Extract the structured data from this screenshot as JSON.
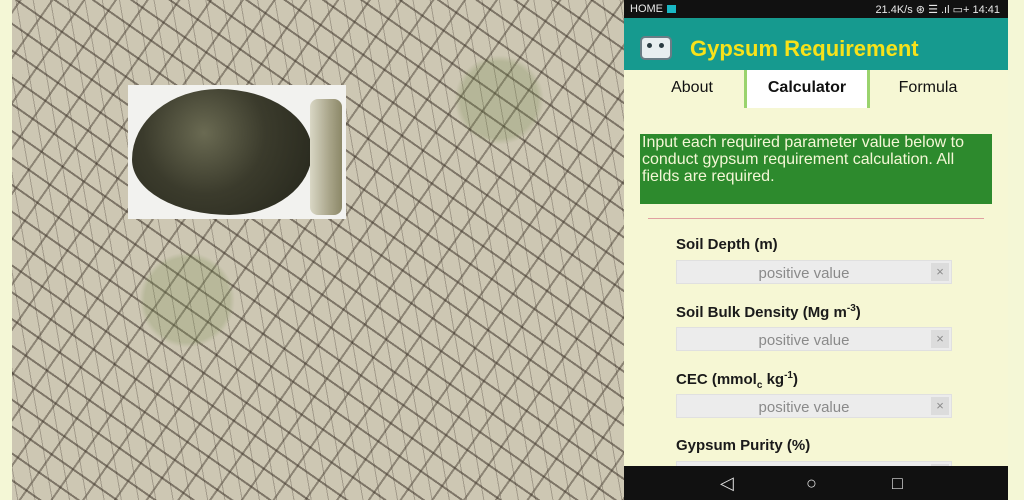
{
  "statusbar": {
    "left": "HOME",
    "right": "21.4K/s ⊛ ☰ .ıl ▭+ 14:41"
  },
  "app": {
    "title": "Gypsum Requirement"
  },
  "tabs": [
    {
      "label": "About"
    },
    {
      "label": "Calculator",
      "selected": true
    },
    {
      "label": "Formula"
    }
  ],
  "info_banner": "Input each required parameter value below to conduct gypsum requirement calculation. All fields are required.",
  "fields": [
    {
      "label_main": "Soil Depth (m)",
      "label_rest": "",
      "placeholder": "positive value",
      "value": ""
    },
    {
      "label_main": "Soil Bulk Density (Mg m",
      "label_sup": "-3",
      "label_rest": ")",
      "placeholder": "positive value",
      "value": ""
    },
    {
      "label_main": "CEC (mmol",
      "label_sub": "c",
      "label_mid": " kg",
      "label_sup": "-1",
      "label_rest": ")",
      "placeholder": "positive value",
      "value": ""
    },
    {
      "label_main": "Gypsum Purity (%)",
      "label_rest": ""
    }
  ],
  "icons": {
    "clear": "×",
    "back": "◁",
    "home": "○",
    "recents": "□"
  },
  "colors": {
    "accent": "#169a8f",
    "title": "#f7e21a",
    "banner": "#2d8a2d",
    "background": "#f6f7d4"
  }
}
